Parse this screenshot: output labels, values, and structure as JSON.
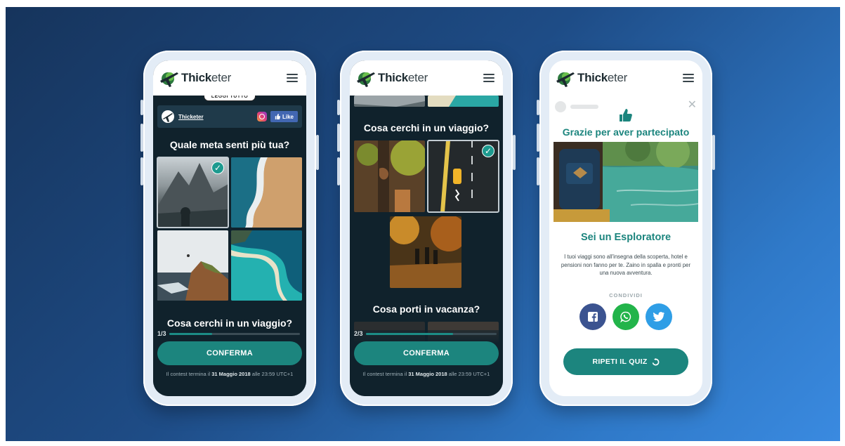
{
  "brand": {
    "bold": "Thick",
    "light": "eter"
  },
  "phone1": {
    "read_more": "LEGGI TUTTO",
    "fb_name": "Thicketer",
    "like_label": "Like",
    "question1": "Quale meta senti più tua?",
    "question2": "Cosa cerchi in un viaggio?",
    "progress_label": "1/3",
    "progress_fraction": 0.33,
    "confirm_label": "CONFERMA",
    "footer": {
      "prefix": "Il contest termina il ",
      "date": "31 Maggio 2018",
      "suffix": " alle 23:59 UTC+1"
    }
  },
  "phone2": {
    "question1": "Cosa cerchi in un viaggio?",
    "question2": "Cosa porti in vacanza?",
    "progress_label": "2/3",
    "progress_fraction": 0.67,
    "confirm_label": "CONFERMA",
    "footer": {
      "prefix": "Il contest termina il ",
      "date": "31 Maggio 2018",
      "suffix": " alle 23:59 UTC+1"
    }
  },
  "phone3": {
    "thanks": "Grazie per aver partecipato",
    "result_title": "Sei un Esploratore",
    "result_desc": "I tuoi viaggi sono all'insegna della scoperta, hotel e pensioni non fanno per te. Zaino in spalla e pronti per una nuova avventura.",
    "share_label": "CONDIVIDI",
    "retry_label": "RIPETI IL QUIZ"
  },
  "colors": {
    "accent": "#1c857e",
    "dark_bg": "#10222c",
    "facebook": "#3b5390",
    "whatsapp": "#22b44a",
    "twitter": "#2f9ee6"
  },
  "icons": [
    "plane-logo-icon",
    "hamburger-menu-icon",
    "checkmark-icon",
    "instagram-icon",
    "thumbs-up-icon",
    "close-icon",
    "facebook-icon",
    "whatsapp-icon",
    "twitter-icon",
    "replay-icon"
  ]
}
